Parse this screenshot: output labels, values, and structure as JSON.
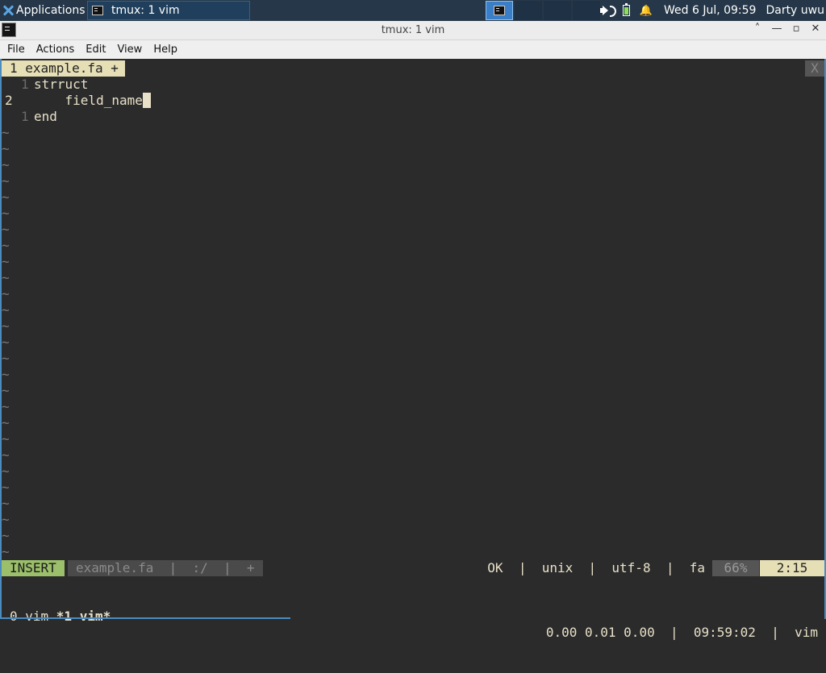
{
  "panel": {
    "apps_label": "Applications",
    "apps_suffix": "≡",
    "task_label": "tmux: 1 vim",
    "clock": "Wed  6 Jul, 09:59",
    "user": "Darty uwu",
    "bell": "🔔"
  },
  "window": {
    "title": "tmux: 1 vim",
    "btn_up": "˄",
    "btn_min": "—",
    "btn_max": "▫",
    "btn_close": "✕"
  },
  "menu": [
    "File",
    "Actions",
    "Edit",
    "View",
    "Help"
  ],
  "vim": {
    "tab_label": "1 example.fa +",
    "tab_close": "X",
    "lines": [
      {
        "num": "1",
        "text": "strruct"
      },
      {
        "num": "2",
        "text": "    field_name"
      },
      {
        "num": "1",
        "text": "end"
      }
    ],
    "tilde": "~",
    "mode": "INSERT",
    "file_info": "example.fa  |  :/  |  +",
    "right_info": "OK  |  unix  |  utf-8  |  fa",
    "percent": "66%",
    "position": "2:15"
  },
  "tmux": {
    "left_prefix": "0 vim ",
    "left_active": "*1 vim*",
    "right": "0.00 0.01 0.00  |  09:59:02  |  vim"
  }
}
